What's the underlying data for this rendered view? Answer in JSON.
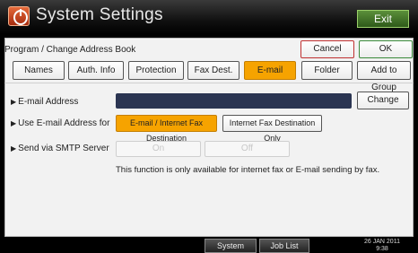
{
  "header": {
    "title": "System Settings",
    "exit_label": "Exit"
  },
  "breadcrumb": "Program / Change Address Book",
  "actions": {
    "cancel": "Cancel",
    "ok": "OK"
  },
  "tabs": [
    "Names",
    "Auth. Info",
    "Protection",
    "Fax Dest.",
    "E-mail",
    "Folder",
    "Add to Group"
  ],
  "active_tab": "E-mail",
  "rows": {
    "email_address": {
      "label": "E-mail Address",
      "value": "",
      "change_label": "Change"
    },
    "use_email": {
      "label": "Use E-mail Address for",
      "options": [
        "E-mail / Internet Fax Destination",
        "Internet Fax Destination Only"
      ],
      "selected": "E-mail / Internet Fax Destination"
    },
    "smtp": {
      "label": "Send via SMTP Server",
      "options": [
        "On",
        "Off"
      ],
      "note": "This function is only available for internet fax or E-mail sending by fax."
    }
  },
  "status": {
    "system_status": "System Status",
    "job_list": "Job List",
    "date": "26 JAN 2011",
    "time": "9:38"
  },
  "colors": {
    "accent": "#f6a300",
    "field": "#2b3552"
  }
}
